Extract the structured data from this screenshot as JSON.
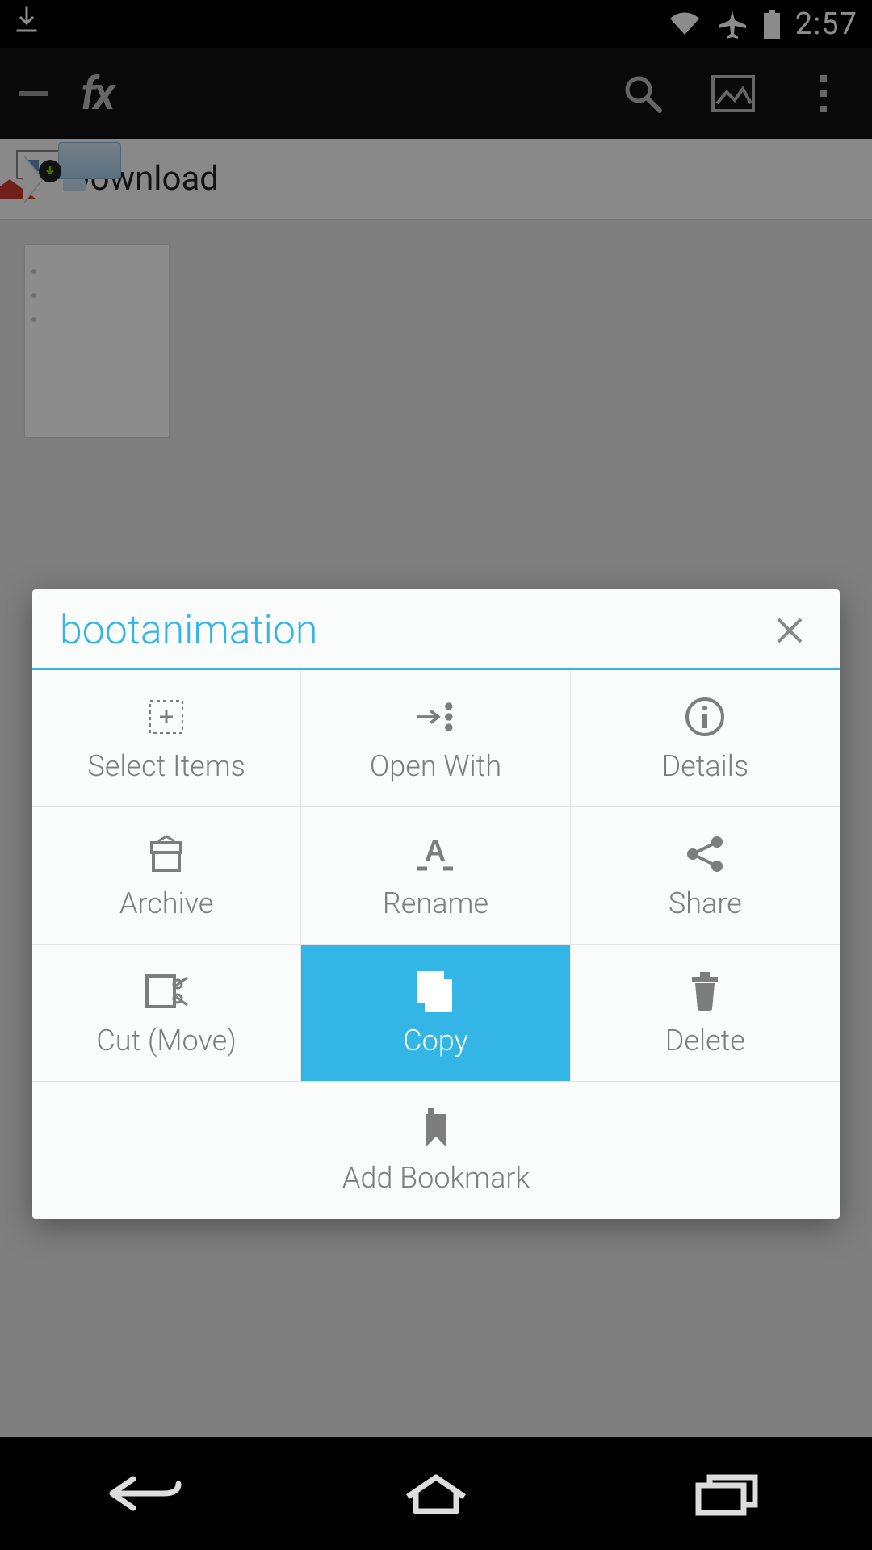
{
  "status_bar": {
    "time": "2:57"
  },
  "app_bar": {
    "logo_text": "fx"
  },
  "breadcrumb": {
    "current": "Download"
  },
  "selected_file": {
    "name": "bootanimation"
  },
  "dialog": {
    "title": "bootanimation",
    "actions": {
      "select_items": "Select Items",
      "open_with": "Open With",
      "details": "Details",
      "archive": "Archive",
      "rename": "Rename",
      "share": "Share",
      "cut": "Cut (Move)",
      "copy": "Copy",
      "delete": "Delete",
      "add_bookmark": "Add Bookmark"
    },
    "highlighted": "copy"
  },
  "colors": {
    "accent": "#33b5e5"
  }
}
